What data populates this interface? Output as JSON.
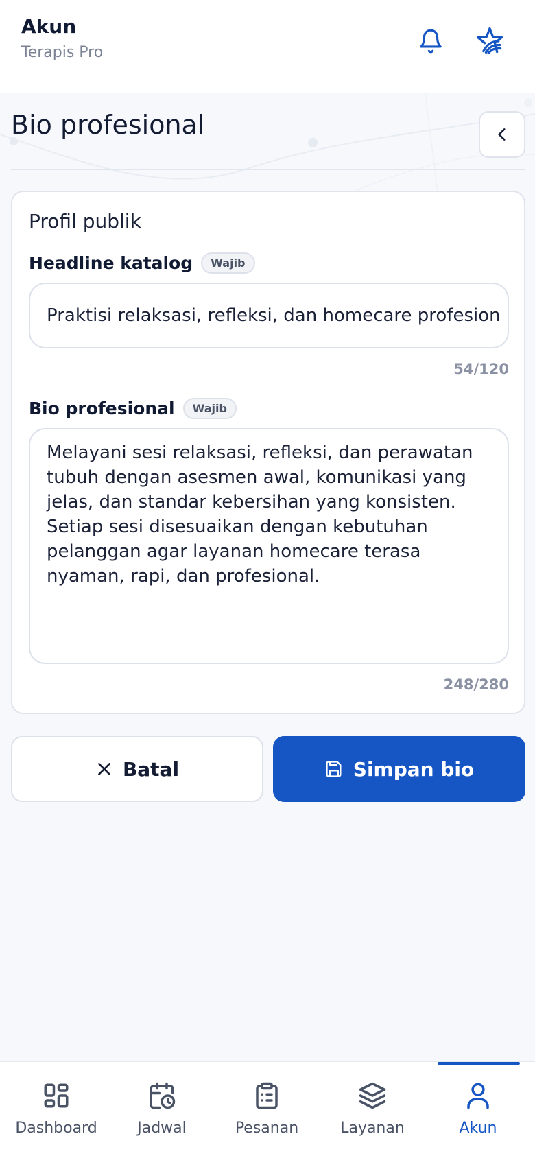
{
  "header": {
    "title": "Akun",
    "subtitle": "Terapis Pro",
    "icons": [
      "bell-icon",
      "brand-logo-icon"
    ]
  },
  "page": {
    "title": "Bio profesional",
    "back_icon": "chevron-left-icon"
  },
  "card": {
    "section_title": "Profil publik",
    "headline": {
      "label": "Headline katalog",
      "badge": "Wajib",
      "value": "Praktisi relaksasi, refleksi, dan homecare profesion",
      "counter": "54/120"
    },
    "bio": {
      "label": "Bio profesional",
      "badge": "Wajib",
      "value": "Melayani sesi relaksasi, refleksi, dan perawatan\ntubuh dengan asesmen awal, komunikasi yang\njelas, dan standar kebersihan yang konsisten.\nSetiap sesi disesuaikan dengan kebutuhan\npelanggan agar layanan homecare terasa\nnyaman, rapi, dan profesional.",
      "counter": "248/280"
    }
  },
  "actions": {
    "cancel_label": "Batal",
    "save_label": "Simpan bio"
  },
  "nav": {
    "items": [
      {
        "label": "Dashboard",
        "icon": "grid-icon"
      },
      {
        "label": "Jadwal",
        "icon": "calendar-clock-icon"
      },
      {
        "label": "Pesanan",
        "icon": "clipboard-icon"
      },
      {
        "label": "Layanan",
        "icon": "layers-icon"
      },
      {
        "label": "Akun",
        "icon": "user-icon"
      }
    ],
    "active": "Akun"
  },
  "colors": {
    "accent": "#1656c4",
    "background": "#f6f8fc",
    "text": "#141c33",
    "muted": "#7a8294"
  }
}
